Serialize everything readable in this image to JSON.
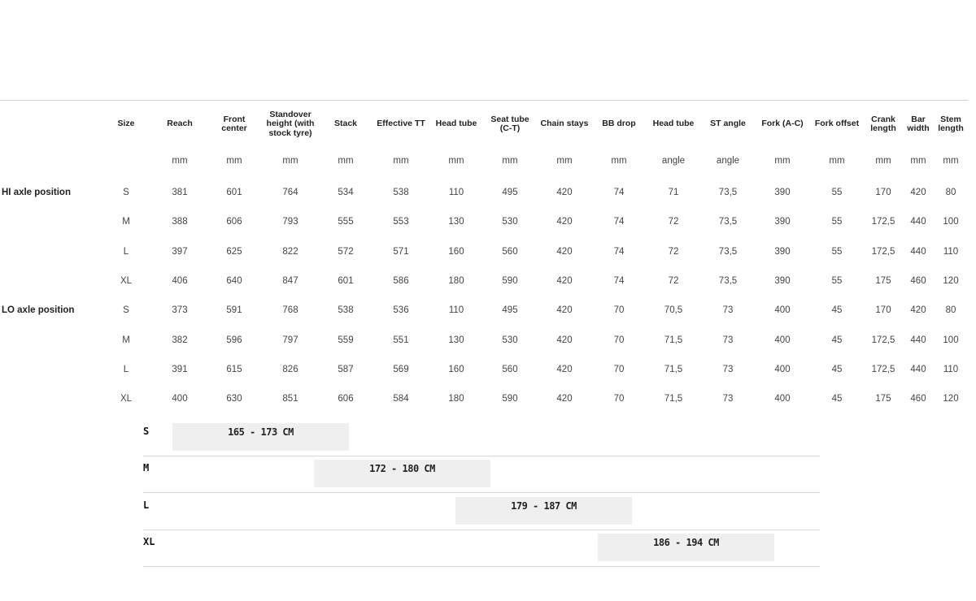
{
  "headers": [
    "Size",
    "Reach",
    "Front center",
    "Standover height (with stock tyre)",
    "Stack",
    "Effective TT",
    "Head tube",
    "Seat tube (C-T)",
    "Chain stays",
    "BB drop",
    "Head tube",
    "ST angle",
    "Fork (A-C)",
    "Fork offset",
    "Crank length",
    "Bar width",
    "Stem length"
  ],
  "units": [
    "",
    "mm",
    "mm",
    "mm",
    "mm",
    "mm",
    "mm",
    "mm",
    "mm",
    "mm",
    "angle",
    "angle",
    "mm",
    "mm",
    "mm",
    "mm",
    "mm"
  ],
  "groups": [
    {
      "label": "HI axle position",
      "rows": [
        [
          "S",
          "381",
          "601",
          "764",
          "534",
          "538",
          "110",
          "495",
          "420",
          "74",
          "71",
          "73,5",
          "390",
          "55",
          "170",
          "420",
          "80"
        ],
        [
          "M",
          "388",
          "606",
          "793",
          "555",
          "553",
          "130",
          "530",
          "420",
          "74",
          "72",
          "73,5",
          "390",
          "55",
          "172,5",
          "440",
          "100"
        ],
        [
          "L",
          "397",
          "625",
          "822",
          "572",
          "571",
          "160",
          "560",
          "420",
          "74",
          "72",
          "73,5",
          "390",
          "55",
          "172,5",
          "440",
          "110"
        ],
        [
          "XL",
          "406",
          "640",
          "847",
          "601",
          "586",
          "180",
          "590",
          "420",
          "74",
          "72",
          "73,5",
          "390",
          "55",
          "175",
          "460",
          "120"
        ]
      ]
    },
    {
      "label": "LO axle position",
      "rows": [
        [
          "S",
          "373",
          "591",
          "768",
          "538",
          "536",
          "110",
          "495",
          "420",
          "70",
          "70,5",
          "73",
          "400",
          "45",
          "170",
          "420",
          "80"
        ],
        [
          "M",
          "382",
          "596",
          "797",
          "559",
          "551",
          "130",
          "530",
          "420",
          "70",
          "71,5",
          "73",
          "400",
          "45",
          "172,5",
          "440",
          "100"
        ],
        [
          "L",
          "391",
          "615",
          "826",
          "587",
          "569",
          "160",
          "560",
          "420",
          "70",
          "71,5",
          "73",
          "400",
          "45",
          "172,5",
          "440",
          "110"
        ],
        [
          "XL",
          "400",
          "630",
          "851",
          "606",
          "584",
          "180",
          "590",
          "420",
          "70",
          "71,5",
          "73",
          "400",
          "45",
          "175",
          "460",
          "120"
        ]
      ]
    }
  ],
  "size_guide": [
    {
      "size": "S",
      "range": "165 - 173 CM",
      "from": 165,
      "to": 173
    },
    {
      "size": "M",
      "range": "172 - 180 CM",
      "from": 172,
      "to": 180
    },
    {
      "size": "L",
      "range": "179 - 187 CM",
      "from": 179,
      "to": 187
    },
    {
      "size": "XL",
      "range": "186 - 194 CM",
      "from": 186,
      "to": 194
    }
  ],
  "colors": {
    "bar": "#efefef",
    "divider": "#d8d8d8",
    "text": "#444444"
  }
}
